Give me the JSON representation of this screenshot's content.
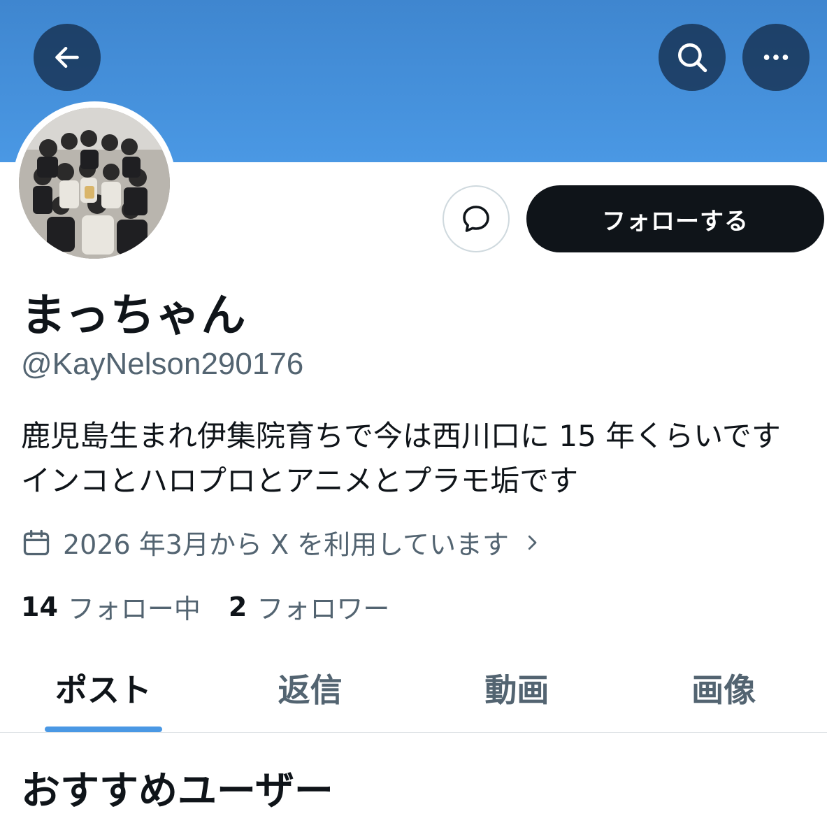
{
  "header": {
    "back_icon": "arrow-left-icon",
    "search_icon": "search-icon",
    "more_icon": "more-horizontal-icon",
    "banner_color": "#4a98e4"
  },
  "profile": {
    "display_name": "まっちゃん",
    "handle": "@KayNelson290176",
    "bio": "鹿児島生まれ伊集院育ちで今は西川口に 15 年くらいです インコとハロプロとアニメとプラモ垢です",
    "joined": "2026 年3月から X を利用しています",
    "following_count": "14",
    "following_label": "フォロー中",
    "followers_count": "2",
    "followers_label": "フォロワー"
  },
  "actions": {
    "message_icon": "message-bubble-icon",
    "follow_label": "フォローする"
  },
  "tabs": [
    {
      "label": "ポスト",
      "active": true
    },
    {
      "label": "返信",
      "active": false
    },
    {
      "label": "動画",
      "active": false
    },
    {
      "label": "画像",
      "active": false
    }
  ],
  "section": {
    "title": "おすすめユーザー"
  },
  "colors": {
    "accent": "#4a98e4",
    "text_primary": "#0f1419",
    "text_secondary": "#536471"
  }
}
